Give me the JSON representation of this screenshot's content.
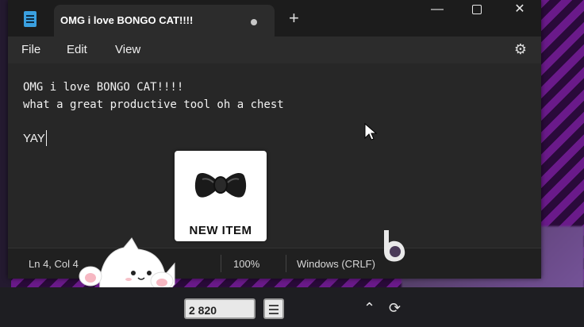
{
  "window": {
    "tab_title": "OMG i love BONGO CAT!!!!",
    "new_tab_label": "+",
    "minimize_label": "—",
    "close_label": "✕"
  },
  "menu": {
    "file": "File",
    "edit": "Edit",
    "view": "View",
    "settings_icon": "gear-icon"
  },
  "editor": {
    "lines": [
      "OMG i love BONGO CAT!!!!",
      "what a great productive tool oh a chest",
      "",
      "YAY"
    ]
  },
  "status": {
    "position": "Ln 4, Col 4",
    "zoom": "100%",
    "line_ending": "Windows (CRLF)"
  },
  "popup": {
    "label": "NEW ITEM",
    "icon": "bowtie-icon"
  },
  "taskbar": {
    "counter": "2 820"
  },
  "colors": {
    "window_bg": "#272727",
    "titlebar_bg": "#1c1c1c",
    "accent_purple": "#6a1a8a"
  }
}
